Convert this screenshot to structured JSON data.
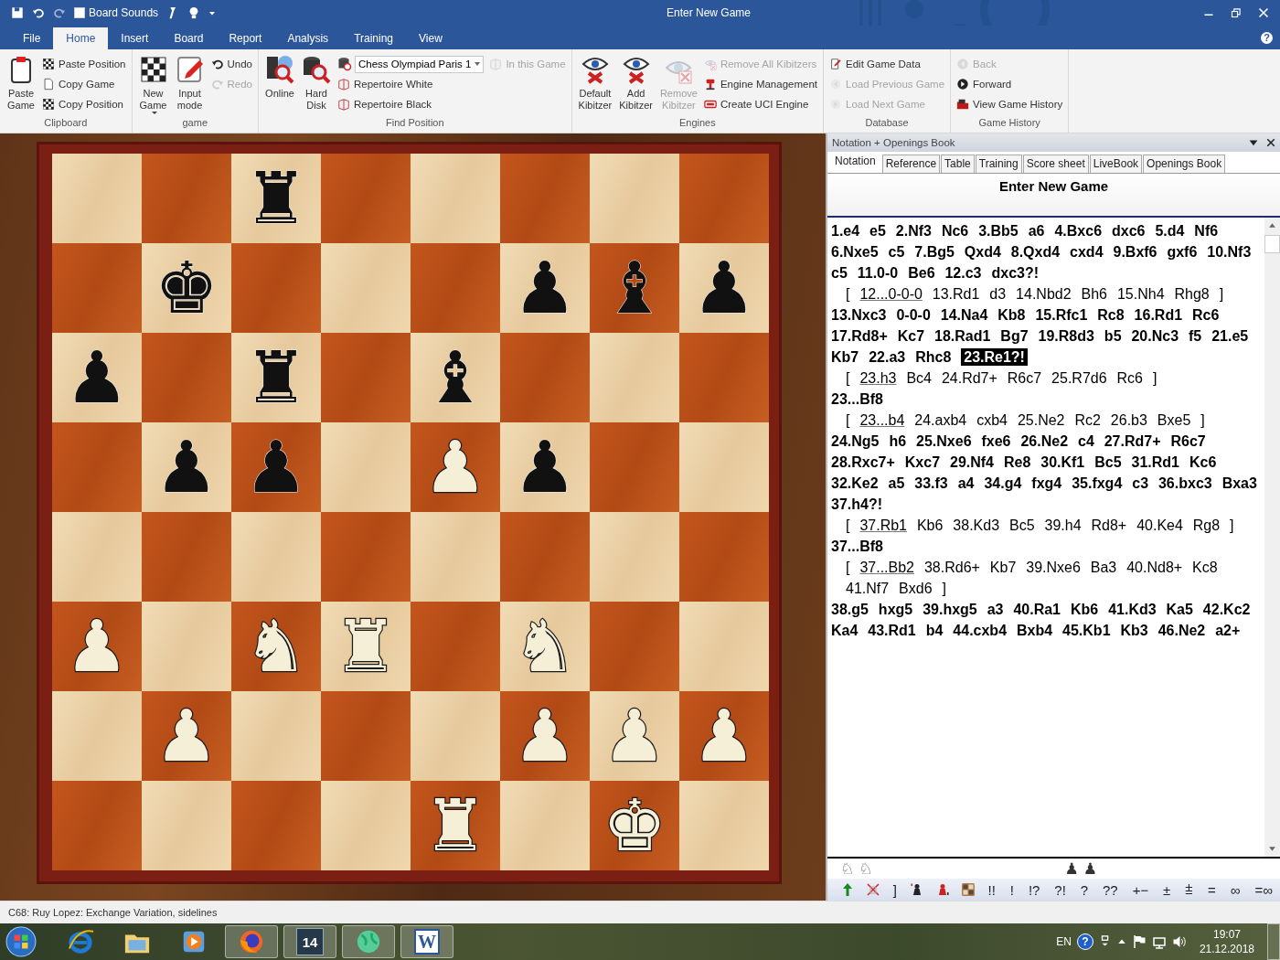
{
  "window": {
    "title": "Enter New Game",
    "help": "?"
  },
  "quick_access": {
    "board_sounds": {
      "label": "Board Sounds",
      "checked": false
    }
  },
  "menu_tabs": [
    {
      "label": "File",
      "selected": false
    },
    {
      "label": "Home",
      "selected": true
    },
    {
      "label": "Insert",
      "selected": false
    },
    {
      "label": "Board",
      "selected": false
    },
    {
      "label": "Report",
      "selected": false
    },
    {
      "label": "Analysis",
      "selected": false
    },
    {
      "label": "Training",
      "selected": false
    },
    {
      "label": "View",
      "selected": false
    }
  ],
  "ribbon": {
    "groups": [
      {
        "label": "Clipboard",
        "columns": [
          {
            "kind": "large",
            "label": "Paste Game",
            "disabled": false,
            "menu": false
          },
          {
            "kind": "stack",
            "items": [
              {
                "kind": "button",
                "label": "Paste Position",
                "disabled": false
              },
              {
                "kind": "button",
                "label": "Copy Game",
                "disabled": false
              },
              {
                "kind": "button",
                "label": "Copy Position",
                "disabled": false
              }
            ]
          }
        ]
      },
      {
        "label": "game",
        "columns": [
          {
            "kind": "large",
            "label": "New Game",
            "disabled": false,
            "menu": true
          },
          {
            "kind": "large",
            "label": "Input mode",
            "disabled": false,
            "menu": false
          },
          {
            "kind": "stack",
            "items": [
              {
                "kind": "button",
                "label": "Undo",
                "disabled": false
              },
              {
                "kind": "button",
                "label": "Redo",
                "disabled": true
              }
            ]
          }
        ]
      },
      {
        "label": "Find Position",
        "columns": [
          {
            "kind": "large",
            "label": "Online",
            "disabled": false,
            "menu": false
          },
          {
            "kind": "large",
            "label": "Hard Disk",
            "disabled": false,
            "menu": false
          },
          {
            "kind": "stack",
            "items": [
              {
                "kind": "combo",
                "label": "Chess Olympiad Paris 1",
                "disabled": false
              },
              {
                "kind": "button",
                "label": "Repertoire White",
                "disabled": false
              },
              {
                "kind": "button",
                "label": "Repertoire Black",
                "disabled": false
              }
            ]
          },
          {
            "kind": "stack",
            "items": [
              {
                "kind": "button",
                "label": "In this Game",
                "disabled": true
              }
            ]
          }
        ]
      },
      {
        "label": "Engines",
        "columns": [
          {
            "kind": "large",
            "label": "Default Kibitzer",
            "disabled": false,
            "menu": false
          },
          {
            "kind": "large",
            "label": "Add Kibitzer",
            "disabled": false,
            "menu": false
          },
          {
            "kind": "large",
            "label": "Remove Kibitzer",
            "disabled": true,
            "menu": false
          },
          {
            "kind": "stack",
            "items": [
              {
                "kind": "button",
                "label": "Remove All Kibitzers",
                "disabled": true
              },
              {
                "kind": "button",
                "label": "Engine Management",
                "disabled": false
              },
              {
                "kind": "button",
                "label": "Create UCI Engine",
                "disabled": false
              }
            ]
          }
        ]
      },
      {
        "label": "Database",
        "columns": [
          {
            "kind": "stack",
            "items": [
              {
                "kind": "button",
                "label": "Edit Game Data",
                "disabled": false
              },
              {
                "kind": "button",
                "label": "Load Previous Game",
                "disabled": true
              },
              {
                "kind": "button",
                "label": "Load Next Game",
                "disabled": true
              }
            ]
          }
        ]
      },
      {
        "label": "Game History",
        "columns": [
          {
            "kind": "stack",
            "items": [
              {
                "kind": "button",
                "label": "Back",
                "disabled": true
              },
              {
                "kind": "button",
                "label": "Forward",
                "disabled": false
              },
              {
                "kind": "button",
                "label": "View Game History",
                "disabled": false
              }
            ]
          }
        ]
      }
    ]
  },
  "board": {
    "ranks": [
      [
        {
          "kind": "empty"
        },
        {
          "kind": "empty"
        },
        {
          "kind": "piece",
          "glyph": "♜",
          "white": false
        },
        {
          "kind": "empty"
        },
        {
          "kind": "empty"
        },
        {
          "kind": "empty"
        },
        {
          "kind": "empty"
        },
        {
          "kind": "empty"
        }
      ],
      [
        {
          "kind": "empty"
        },
        {
          "kind": "piece",
          "glyph": "♚",
          "white": false
        },
        {
          "kind": "empty"
        },
        {
          "kind": "empty"
        },
        {
          "kind": "empty"
        },
        {
          "kind": "piece",
          "glyph": "♟",
          "white": false
        },
        {
          "kind": "piece",
          "glyph": "♝",
          "white": false
        },
        {
          "kind": "piece",
          "glyph": "♟",
          "white": false
        }
      ],
      [
        {
          "kind": "piece",
          "glyph": "♟",
          "white": false
        },
        {
          "kind": "empty"
        },
        {
          "kind": "piece",
          "glyph": "♜",
          "white": false
        },
        {
          "kind": "empty"
        },
        {
          "kind": "piece",
          "glyph": "♝",
          "white": false
        },
        {
          "kind": "empty"
        },
        {
          "kind": "empty"
        },
        {
          "kind": "empty"
        }
      ],
      [
        {
          "kind": "empty"
        },
        {
          "kind": "piece",
          "glyph": "♟",
          "white": false
        },
        {
          "kind": "piece",
          "glyph": "♟",
          "white": false
        },
        {
          "kind": "empty"
        },
        {
          "kind": "piece",
          "glyph": "♟",
          "white": true
        },
        {
          "kind": "piece",
          "glyph": "♟",
          "white": false
        },
        {
          "kind": "empty"
        },
        {
          "kind": "empty"
        }
      ],
      [
        {
          "kind": "empty"
        },
        {
          "kind": "empty"
        },
        {
          "kind": "empty"
        },
        {
          "kind": "empty"
        },
        {
          "kind": "empty"
        },
        {
          "kind": "empty"
        },
        {
          "kind": "empty"
        },
        {
          "kind": "empty"
        }
      ],
      [
        {
          "kind": "piece",
          "glyph": "♟",
          "white": true
        },
        {
          "kind": "empty"
        },
        {
          "kind": "piece",
          "glyph": "♞",
          "white": true
        },
        {
          "kind": "piece",
          "glyph": "♜",
          "white": true
        },
        {
          "kind": "empty"
        },
        {
          "kind": "piece",
          "glyph": "♞",
          "white": true
        },
        {
          "kind": "empty"
        },
        {
          "kind": "empty"
        }
      ],
      [
        {
          "kind": "empty"
        },
        {
          "kind": "piece",
          "glyph": "♟",
          "white": true
        },
        {
          "kind": "empty"
        },
        {
          "kind": "empty"
        },
        {
          "kind": "empty"
        },
        {
          "kind": "piece",
          "glyph": "♟",
          "white": true
        },
        {
          "kind": "piece",
          "glyph": "♟",
          "white": true
        },
        {
          "kind": "piece",
          "glyph": "♟",
          "white": true
        }
      ],
      [
        {
          "kind": "empty"
        },
        {
          "kind": "empty"
        },
        {
          "kind": "empty"
        },
        {
          "kind": "empty"
        },
        {
          "kind": "piece",
          "glyph": "♜",
          "white": true
        },
        {
          "kind": "empty"
        },
        {
          "kind": "piece",
          "glyph": "♚",
          "white": true
        },
        {
          "kind": "empty"
        }
      ]
    ]
  },
  "notation_panel": {
    "title": "Notation + Openings Book",
    "tabs": [
      {
        "label": "Notation",
        "selected": true
      },
      {
        "label": "Reference",
        "selected": false
      },
      {
        "label": "Table",
        "selected": false
      },
      {
        "label": "Training",
        "selected": false
      },
      {
        "label": "Score sheet",
        "selected": false
      },
      {
        "label": "LiveBook",
        "selected": false
      },
      {
        "label": "Openings Book",
        "selected": false
      }
    ],
    "heading": "Enter New Game",
    "blocks": [
      {
        "kind": "main",
        "segments": [
          {
            "text": "1.e4 e5 2.Nf3 Nc6 3.Bb5 a6 4.Bxc6 dxc6 5.d4 Nf6 6.Nxe5 c5 7.Bg5 Qxd4 8.Qxd4 cxd4 9.Bxf6 gxf6 10.Nf3 c5 11.0-0 Be6 12.c3 dxc3?!",
            "selected": false
          }
        ]
      },
      {
        "kind": "variation",
        "before": "[",
        "link": "12...0-0-0",
        "after": "13.Rd1 d3 14.Nbd2 Bh6 15.Nh4 Rhg8 ]"
      },
      {
        "kind": "main",
        "segments": [
          {
            "text": "13.Nxc3 0-0-0 14.Na4 Kb8 15.Rfc1 Rc8 16.Rd1 Rc6 17.Rd8+ Kc7 18.Rad1 Bg7 19.R8d3 b5 20.Nc3 f5 21.e5 Kb7 22.a3 Rhc8",
            "selected": false
          },
          {
            "text": "23.Re1?!",
            "selected": true
          }
        ]
      },
      {
        "kind": "variation",
        "before": "[",
        "link": "23.h3",
        "after": "Bc4 24.Rd7+ R6c7 25.R7d6 Rc6 ]"
      },
      {
        "kind": "main",
        "segments": [
          {
            "text": "23...Bf8",
            "selected": false
          }
        ]
      },
      {
        "kind": "variation",
        "before": "[",
        "link": "23...b4",
        "after": "24.axb4 cxb4 25.Ne2 Rc2 26.b3 Bxe5 ]"
      },
      {
        "kind": "main",
        "segments": [
          {
            "text": "24.Ng5 h6 25.Nxe6 fxe6 26.Ne2 c4 27.Rd7+ R6c7 28.Rxc7+ Kxc7 29.Nf4 Re8 30.Kf1 Bc5 31.Rd1 Kc6 32.Ke2 a5 33.f3 a4 34.g4 fxg4 35.fxg4 c3 36.bxc3 Bxa3 37.h4?!",
            "selected": false
          }
        ]
      },
      {
        "kind": "variation",
        "before": "[",
        "link": "37.Rb1",
        "after": "Kb6 38.Kd3 Bc5 39.h4 Rd8+ 40.Ke4 Rg8 ]"
      },
      {
        "kind": "main",
        "segments": [
          {
            "text": "37...Bf8",
            "selected": false
          }
        ]
      },
      {
        "kind": "variation",
        "before": "[",
        "link": "37...Bb2",
        "after": "38.Rd6+ Kb7 39.Nxe6 Ba3 40.Nd8+ Kc8 41.Nf7 Bxd6 ]"
      },
      {
        "kind": "main",
        "segments": [
          {
            "text": "38.g5 hxg5 39.hxg5 a3 40.Ra1 Kb6 41.Kd3 Ka5 42.Kc2 Ka4 43.Rd1 b4 44.cxb4 Bxb4 45.Kb1 Kb3 46.Ne2 a2+",
            "selected": false
          }
        ]
      }
    ],
    "piece_buttons": [
      {
        "kind": "knight",
        "glyph": "♘"
      },
      {
        "kind": "knight",
        "glyph": "♘"
      },
      {
        "kind": "gap"
      },
      {
        "kind": "pawn",
        "glyph": "♟"
      },
      {
        "kind": "pawn",
        "glyph": "♟"
      }
    ],
    "toolbar": [
      {
        "kind": "icon"
      },
      {
        "kind": "icon"
      },
      {
        "kind": "text",
        "text": "]"
      },
      {
        "kind": "icon"
      },
      {
        "kind": "icon"
      },
      {
        "kind": "icon"
      },
      {
        "kind": "text",
        "text": "!!"
      },
      {
        "kind": "text",
        "text": "!"
      },
      {
        "kind": "text",
        "text": "!?"
      },
      {
        "kind": "text",
        "text": "?!"
      },
      {
        "kind": "text",
        "text": "?"
      },
      {
        "kind": "text",
        "text": "??"
      },
      {
        "kind": "text",
        "text": "+−"
      },
      {
        "kind": "text",
        "text": "±"
      },
      {
        "kind": "text",
        "text": "⩲"
      },
      {
        "kind": "text",
        "text": "="
      },
      {
        "kind": "text",
        "text": "∞"
      },
      {
        "kind": "text",
        "text": "=∞"
      }
    ]
  },
  "status_bar": "C68: Ruy Lopez: Exchange Variation, sidelines",
  "taskbar": {
    "apps": [
      {
        "running": false
      },
      {
        "running": false
      },
      {
        "running": false
      },
      {
        "running": true
      },
      {
        "running": true,
        "text": "14"
      },
      {
        "running": true
      },
      {
        "running": true,
        "text": "W"
      }
    ],
    "tray": {
      "language": "EN",
      "help": "?",
      "time": "19:07",
      "date": "21.12.2018"
    }
  }
}
